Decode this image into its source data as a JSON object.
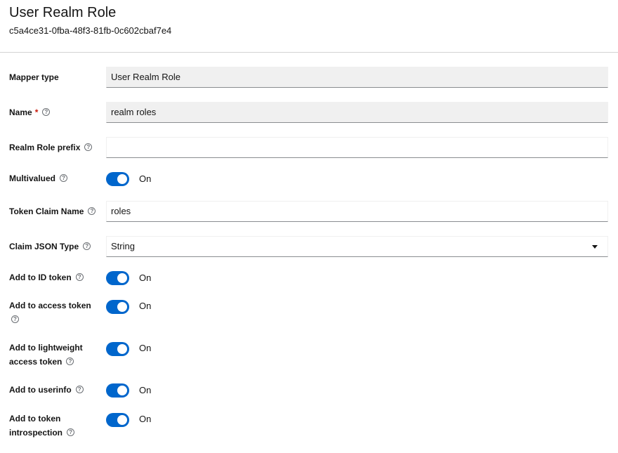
{
  "header": {
    "title": "User Realm Role",
    "subtitle": "c5a4ce31-0fba-48f3-81fb-0c602cbaf7e4"
  },
  "form": {
    "mapper_type": {
      "label": "Mapper type",
      "value": "User Realm Role"
    },
    "name": {
      "label": "Name",
      "required_mark": "*",
      "value": "realm roles"
    },
    "realm_role_prefix": {
      "label": "Realm Role prefix",
      "value": ""
    },
    "multivalued": {
      "label": "Multivalued",
      "state": "On"
    },
    "token_claim_name": {
      "label": "Token Claim Name",
      "value": "roles"
    },
    "claim_json_type": {
      "label": "Claim JSON Type",
      "value": "String"
    },
    "add_to_id_token": {
      "label": "Add to ID token",
      "state": "On"
    },
    "add_to_access_token": {
      "label": "Add to access token",
      "state": "On"
    },
    "add_to_lightweight_access_token": {
      "label_line1": "Add to lightweight",
      "label_line2": "access token",
      "state": "On"
    },
    "add_to_userinfo": {
      "label": "Add to userinfo",
      "state": "On"
    },
    "add_to_token_introspection": {
      "label_line1": "Add to token",
      "label_line2": "introspection",
      "state": "On"
    }
  },
  "help_icon_glyph": "?",
  "colors": {
    "accent": "#0066cc",
    "required": "#c9190b"
  }
}
